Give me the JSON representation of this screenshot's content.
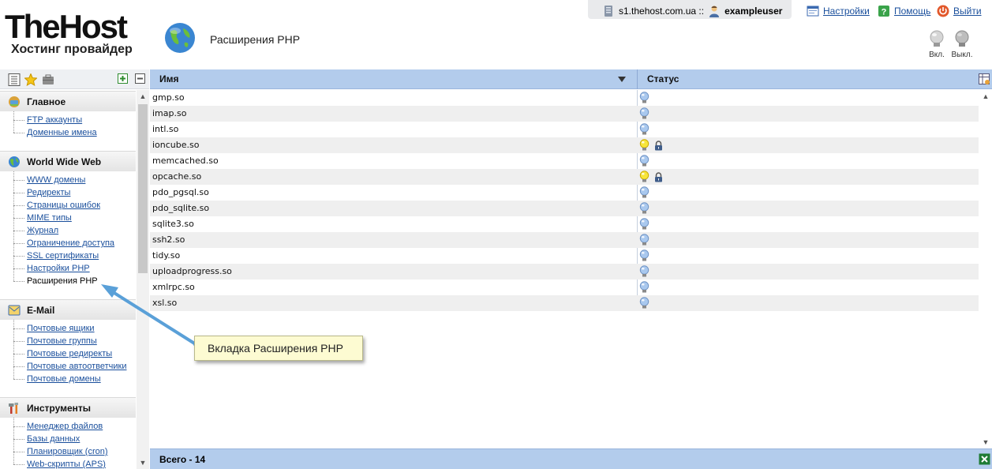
{
  "header": {
    "logo_brand": "TheHost",
    "logo_tagline": "Хостинг провайдер",
    "page_title": "Расширения PHP"
  },
  "topbar": {
    "server": "s1.thehost.com.ua ::",
    "user": "exampleuser",
    "settings": "Настройки",
    "help": "Помощь",
    "logout": "Выйти"
  },
  "lamps": {
    "on": "Вкл.",
    "off": "Выкл."
  },
  "sidebar": {
    "sections": [
      {
        "title": "Главное",
        "icon": "home-icon",
        "items": [
          "FTP аккаунты",
          "Доменные имена"
        ]
      },
      {
        "title": "World Wide Web",
        "icon": "globe-icon",
        "items": [
          "WWW домены",
          "Редиректы",
          "Страницы ошибок",
          "MIME типы",
          "Журнал",
          "Ограничение доступа",
          "SSL сертификаты",
          "Настройки PHP",
          "Расширения PHP"
        ]
      },
      {
        "title": "E-Mail",
        "icon": "mail-icon",
        "items": [
          "Почтовые ящики",
          "Почтовые группы",
          "Почтовые редиректы",
          "Почтовые автоответчики",
          "Почтовые домены"
        ]
      },
      {
        "title": "Инструменты",
        "icon": "tools-icon",
        "items": [
          "Менеджер файлов",
          "Базы данных",
          "Планировщик (cron)",
          "Web-скрипты (APS)"
        ]
      }
    ],
    "current_item": "Расширения PHP"
  },
  "table": {
    "columns": [
      "Имя",
      "Статус"
    ],
    "rows": [
      {
        "name": "gmp.so",
        "status": "off",
        "locked": false
      },
      {
        "name": "imap.so",
        "status": "off",
        "locked": false
      },
      {
        "name": "intl.so",
        "status": "off",
        "locked": false
      },
      {
        "name": "ioncube.so",
        "status": "on",
        "locked": true
      },
      {
        "name": "memcached.so",
        "status": "off",
        "locked": false
      },
      {
        "name": "opcache.so",
        "status": "on",
        "locked": true
      },
      {
        "name": "pdo_pgsql.so",
        "status": "off",
        "locked": false
      },
      {
        "name": "pdo_sqlite.so",
        "status": "off",
        "locked": false
      },
      {
        "name": "sqlite3.so",
        "status": "off",
        "locked": false
      },
      {
        "name": "ssh2.so",
        "status": "off",
        "locked": false
      },
      {
        "name": "tidy.so",
        "status": "off",
        "locked": false
      },
      {
        "name": "uploadprogress.so",
        "status": "off",
        "locked": false
      },
      {
        "name": "xmlrpc.so",
        "status": "off",
        "locked": false
      },
      {
        "name": "xsl.so",
        "status": "off",
        "locked": false
      }
    ],
    "footer": "Всего - 14"
  },
  "callout": {
    "text": "Вкладка Расширения PHP"
  },
  "colors": {
    "header_bar": "#b3ccec",
    "link": "#1a4f9c",
    "row_alt": "#efefef",
    "callout_bg": "#fdfbd2",
    "arrow": "#5aa0d8"
  }
}
